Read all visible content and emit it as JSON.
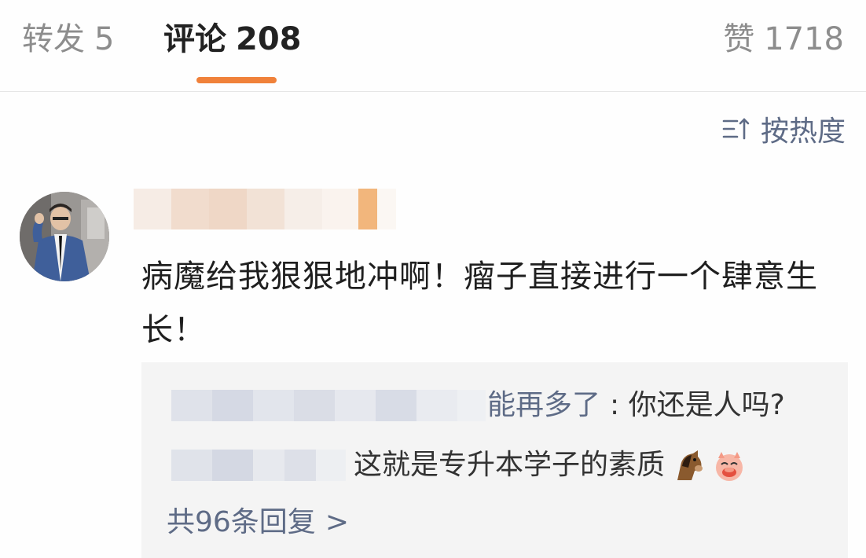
{
  "tabs": {
    "repost": {
      "label": "转发",
      "count": "5"
    },
    "comment": {
      "label": "评论",
      "count": "208"
    },
    "likes": {
      "label": "赞",
      "count": "1718"
    },
    "active_color": "#f0813a"
  },
  "sort": {
    "label": "按热度",
    "icon": "sort-icon"
  },
  "comment": {
    "avatar_icon": "user-avatar",
    "text": "病魔给我狠狠地冲啊！瘤子直接进行一个肆意生长！"
  },
  "replies": {
    "items": [
      {
        "visible_name_fragment": "能再多了",
        "text": ": 你还是人吗?"
      },
      {
        "text": "这就是专升本学子的素质",
        "emojis": [
          "horse-emoji",
          "pig-emoji"
        ]
      }
    ],
    "more_label": "共96条回复",
    "more_chevron": ">"
  },
  "colors": {
    "link": "#5e6b86",
    "muted": "#8d8d8d",
    "accent": "#f0813a"
  }
}
